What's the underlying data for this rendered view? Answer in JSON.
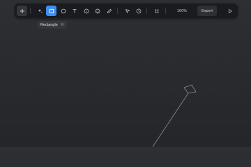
{
  "toolbar": {
    "tools": [
      {
        "name": "add",
        "icon": "plus-icon"
      },
      {
        "name": "ai",
        "icon": "sparkles-icon"
      },
      {
        "name": "rectangle",
        "icon": "square-icon",
        "active": true
      },
      {
        "name": "ellipse",
        "icon": "circle-icon"
      },
      {
        "name": "text",
        "icon": "text-icon"
      },
      {
        "name": "info",
        "icon": "info-icon"
      },
      {
        "name": "emoji",
        "icon": "smiley-icon"
      },
      {
        "name": "pen",
        "icon": "pen-icon"
      },
      {
        "name": "select",
        "icon": "cursor-icon"
      },
      {
        "name": "timer",
        "icon": "clock-icon"
      },
      {
        "name": "frame",
        "icon": "frame-icon"
      },
      {
        "name": "present",
        "icon": "play-icon"
      }
    ],
    "zoom_label": "100%",
    "export_label": "Export"
  },
  "tooltip": {
    "label": "Rectangle",
    "shortcut": "R"
  },
  "colors": {
    "accent": "#3d8ef0",
    "toolbar_bg": "#1a1b1e",
    "canvas_bg": "#2a2b2f",
    "stroke": "#8a8c90"
  }
}
